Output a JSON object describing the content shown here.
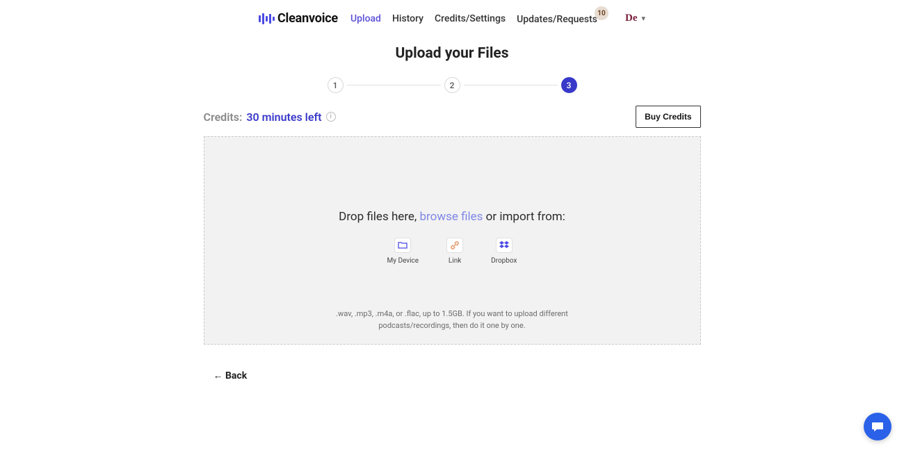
{
  "brand": {
    "name": "Cleanvoice"
  },
  "nav": {
    "upload": "Upload",
    "history": "History",
    "credits": "Credits/Settings",
    "updates": "Updates/Requests",
    "updates_badge": "10"
  },
  "user": {
    "label": "De"
  },
  "page": {
    "title": "Upload your Files",
    "steps": [
      "1",
      "2",
      "3"
    ]
  },
  "credits": {
    "label": "Credits:",
    "value": "30 minutes left",
    "buy": "Buy Credits"
  },
  "dropzone": {
    "prefix": "Drop files here, ",
    "browse": "browse files",
    "suffix": " or import from:",
    "sources": {
      "device": "My Device",
      "link": "Link",
      "dropbox": "Dropbox"
    },
    "hint": ".wav, .mp3, .m4a, or .flac, up to 1.5GB. If you want to upload different podcasts/recordings, then do it one by one."
  },
  "back": "← Back"
}
